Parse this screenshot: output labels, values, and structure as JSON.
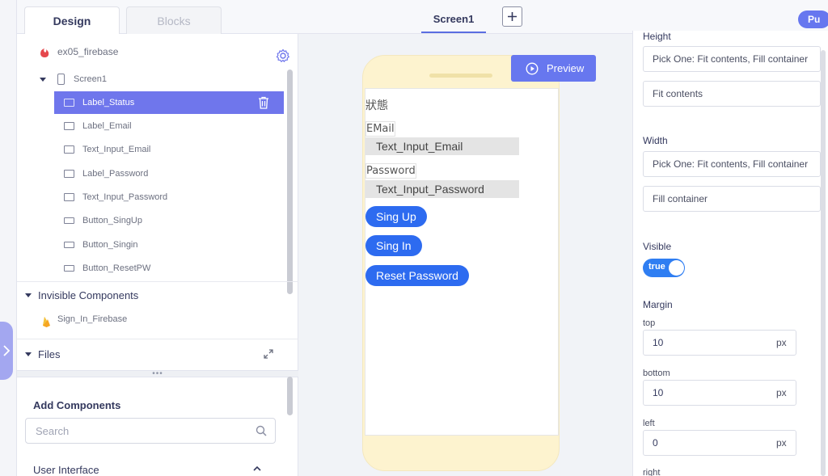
{
  "top": {
    "tab_design": "Design",
    "tab_blocks": "Blocks",
    "screen_tab": "Screen1",
    "add_screen": "+",
    "publish_label": "Pu"
  },
  "project": {
    "name": "ex05_firebase"
  },
  "tree": {
    "screen": "Screen1",
    "items": [
      {
        "label": "Label_Status",
        "selected": true
      },
      {
        "label": "Label_Email"
      },
      {
        "label": "Text_Input_Email"
      },
      {
        "label": "Label_Password"
      },
      {
        "label": "Text_Input_Password"
      },
      {
        "label": "Button_SingUp"
      },
      {
        "label": "Button_Singin"
      },
      {
        "label": "Button_ResetPW"
      }
    ]
  },
  "invisible": {
    "header": "Invisible Components",
    "items": [
      {
        "label": "Sign_In_Firebase"
      }
    ]
  },
  "files": {
    "header": "Files"
  },
  "resize_handle": "•••",
  "add_components": {
    "title": "Add Components",
    "search_placeholder": "Search",
    "section": "User Interface"
  },
  "canvas": {
    "preview_label": "Preview",
    "screen": {
      "status_label": "狀態",
      "email_label": "EMail",
      "email_input": "Text_Input_Email",
      "password_label": "Password",
      "password_input": "Text_Input_Password",
      "buttons": [
        "Sing Up",
        "Sing In",
        "Reset Password"
      ]
    }
  },
  "properties": {
    "height_title": "Height",
    "height_pick": "Pick One: Fit contents, Fill container",
    "height_value": "Fit contents",
    "width_title": "Width",
    "width_pick": "Pick One: Fit contents, Fill container",
    "width_value": "Fill container",
    "visible_title": "Visible",
    "visible_value": "true",
    "margin_title": "Margin",
    "margins": [
      {
        "label": "top",
        "value": "10",
        "unit": "px"
      },
      {
        "label": "bottom",
        "value": "10",
        "unit": "px"
      },
      {
        "label": "left",
        "value": "0",
        "unit": "px"
      },
      {
        "label": "right"
      }
    ]
  },
  "colors": {
    "accent": "#6777ef",
    "selected_row": "#6f76ec",
    "app_button": "#2d6bf0",
    "toggle_on": "#2f7ef2",
    "phone_frame": "#fdf3cf"
  }
}
